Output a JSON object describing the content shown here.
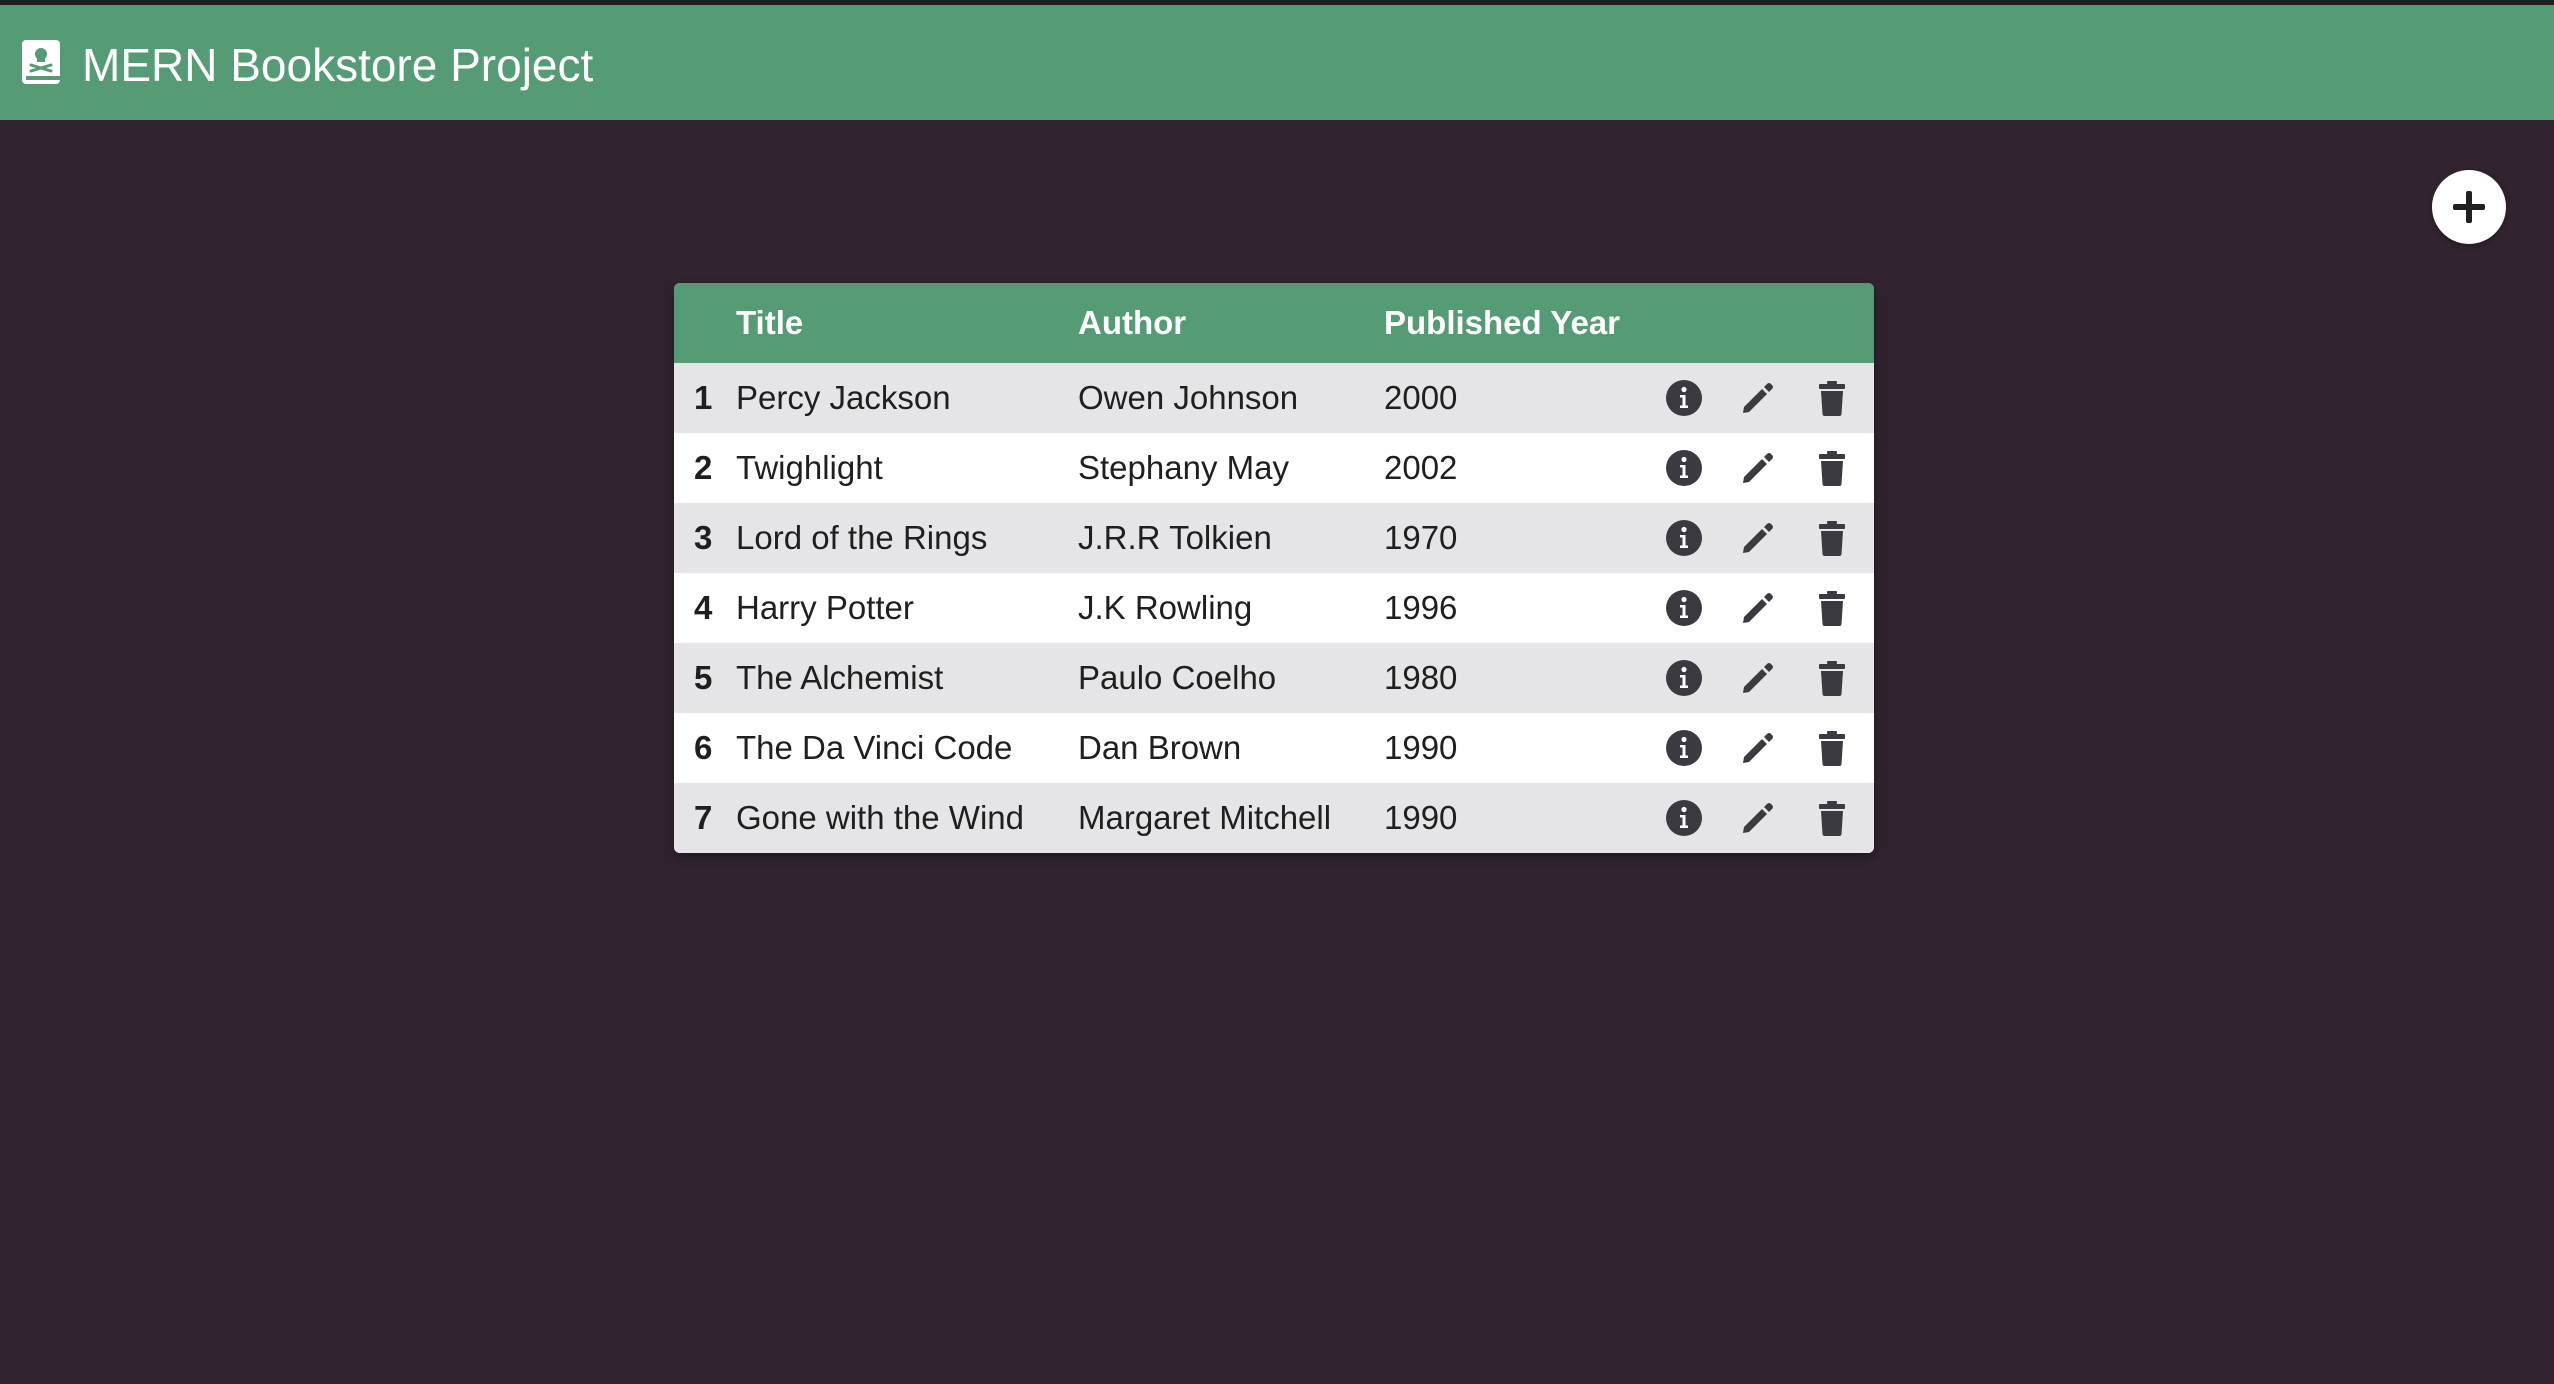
{
  "app": {
    "title": "MERN Bookstore Project",
    "brand_icon": "book-skull-icon"
  },
  "toolbar": {
    "add_icon": "plus-circle-icon"
  },
  "colors": {
    "accent": "#549b76",
    "background": "#312430",
    "row_alt": "#e5e5e8",
    "icon": "#3a3a40"
  },
  "table": {
    "columns": [
      "",
      "Title",
      "Author",
      "Published Year",
      ""
    ],
    "rows": [
      {
        "num": "1",
        "title": "Percy Jackson",
        "author": "Owen Johnson",
        "year": "2000"
      },
      {
        "num": "2",
        "title": "Twighlight",
        "author": "Stephany May",
        "year": "2002"
      },
      {
        "num": "3",
        "title": "Lord of the Rings",
        "author": "J.R.R Tolkien",
        "year": "1970"
      },
      {
        "num": "4",
        "title": "Harry Potter",
        "author": "J.K Rowling",
        "year": "1996"
      },
      {
        "num": "5",
        "title": "The Alchemist",
        "author": "Paulo Coelho",
        "year": "1980"
      },
      {
        "num": "6",
        "title": "The Da Vinci Code",
        "author": "Dan Brown",
        "year": "1990"
      },
      {
        "num": "7",
        "title": "Gone with the Wind",
        "author": "Margaret Mitchell",
        "year": "1990"
      }
    ],
    "row_actions": [
      "info-circle-icon",
      "pencil-icon",
      "trash-icon"
    ]
  }
}
